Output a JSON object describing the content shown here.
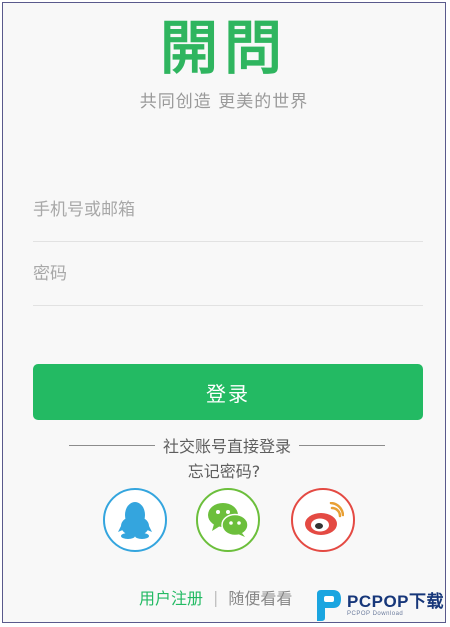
{
  "brand": {
    "logo_text": "開問",
    "slogan": "共同创造 更美的世界"
  },
  "form": {
    "account_placeholder": "手机号或邮箱",
    "password_placeholder": "密码",
    "login_label": "登录"
  },
  "social": {
    "divider_label": "社交账号直接登录",
    "forgot_label": "忘记密码?",
    "providers": [
      "qq-icon",
      "wechat-icon",
      "weibo-icon"
    ]
  },
  "footer": {
    "register_label": "用户注册",
    "separator": "|",
    "browse_label": "随便看看"
  },
  "watermark": {
    "main": "PCPOP下载",
    "sub": "PCPOP Download"
  },
  "colors": {
    "brand_green": "#23ba63",
    "qq_blue": "#34a5de",
    "wechat_green": "#6cbf3c",
    "weibo_red": "#e44a43"
  }
}
